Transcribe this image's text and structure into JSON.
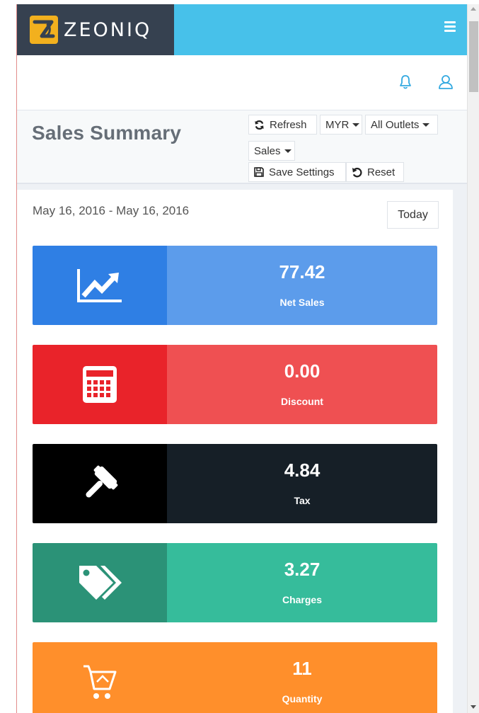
{
  "brand": {
    "name": "ZEONIQ",
    "logo_icon": "zeoniq-logo-icon"
  },
  "header": {
    "menu_icon": "hamburger-menu-icon",
    "notification_icon": "bell-icon",
    "user_icon": "user-icon"
  },
  "page": {
    "title": "Sales Summary"
  },
  "toolbar": {
    "refresh_label": "Refresh",
    "currency_label": "MYR",
    "outlets_label": "All Outlets",
    "metric_label": "Sales",
    "save_label": "Save Settings",
    "reset_label": "Reset"
  },
  "report": {
    "date_range": "May 16, 2016 - May 16, 2016",
    "today_label": "Today"
  },
  "stats": [
    {
      "value": "77.42",
      "label": "Net Sales",
      "icon": "trend-chart-icon",
      "icon_color": "#2f7fe4",
      "body_color": "#5c9ceb"
    },
    {
      "value": "0.00",
      "label": "Discount",
      "icon": "calculator-icon",
      "icon_color": "#e9232a",
      "body_color": "#ef5052"
    },
    {
      "value": "4.84",
      "label": "Tax",
      "icon": "gavel-icon",
      "icon_color": "#000000",
      "body_color": "#161f27"
    },
    {
      "value": "3.27",
      "label": "Charges",
      "icon": "tags-icon",
      "icon_color": "#2b9277",
      "body_color": "#36bc9b"
    },
    {
      "value": "11",
      "label": "Quantity",
      "icon": "shopping-cart-icon",
      "icon_color": "#ff8f2b",
      "body_color": "#ff8f2b"
    }
  ]
}
